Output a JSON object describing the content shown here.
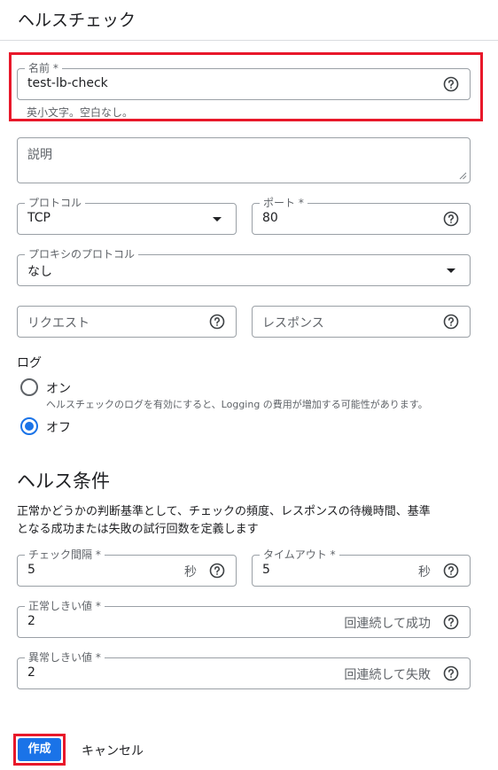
{
  "page": {
    "title": "ヘルスチェック"
  },
  "name_field": {
    "label": "名前 *",
    "value": "test-lb-check",
    "hint": "英小文字。空白なし。"
  },
  "description_field": {
    "placeholder": "説明"
  },
  "protocol_field": {
    "label": "プロトコル",
    "value": "TCP"
  },
  "port_field": {
    "label": "ポート *",
    "value": "80"
  },
  "proxy_protocol_field": {
    "label": "プロキシのプロトコル",
    "value": "なし"
  },
  "request_field": {
    "placeholder": "リクエスト"
  },
  "response_field": {
    "placeholder": "レスポンス"
  },
  "logs": {
    "heading": "ログ",
    "on_label": "オン",
    "on_description": "ヘルスチェックのログを有効にすると、Logging の費用が増加する可能性があります。",
    "off_label": "オフ",
    "selected": "オフ"
  },
  "health_criteria": {
    "heading": "ヘルス条件",
    "description_line1": "正常かどうかの判断基準として、チェックの頻度、レスポンスの待機時間、基準",
    "description_line2": "となる成功または失敗の試行回数を定義します",
    "check_interval": {
      "label": "チェック間隔 *",
      "value": "5",
      "unit": "秒"
    },
    "timeout": {
      "label": "タイムアウト *",
      "value": "5",
      "unit": "秒"
    },
    "healthy_threshold": {
      "label": "正常しきい値 *",
      "value": "2",
      "unit": "回連続して成功"
    },
    "unhealthy_threshold": {
      "label": "異常しきい値 *",
      "value": "2",
      "unit": "回連続して失敗"
    }
  },
  "actions": {
    "create_label": "作成",
    "cancel_label": "キャンセル"
  },
  "colors": {
    "accent": "#1a73e8",
    "highlight": "#e8182a",
    "border": "#9aa0a6"
  },
  "icons": [
    "help-icon",
    "dropdown-arrow-icon",
    "resize-handle-icon"
  ]
}
